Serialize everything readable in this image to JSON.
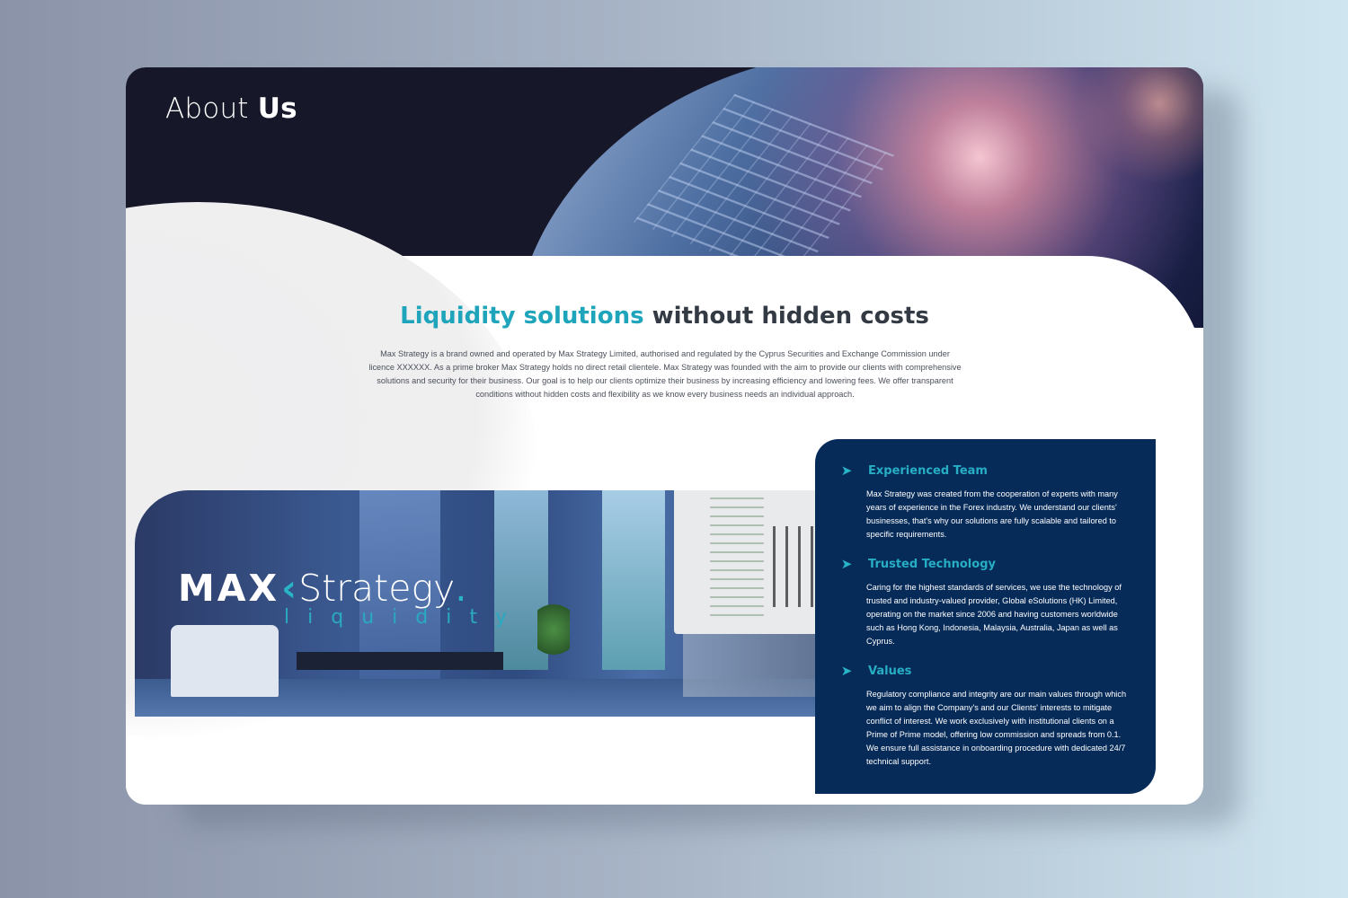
{
  "hero": {
    "title_light": "About",
    "title_bold": "Us"
  },
  "intro": {
    "title_accent": "Liquidity solutions",
    "title_rest": "without hidden costs",
    "body": "Max Strategy is a brand owned and operated by Max Strategy Limited, authorised and regulated by the Cyprus Securities and Exchange Commission under licence XXXXXX. As a prime broker Max Strategy holds no direct retail clientele. Max Strategy was founded with the aim to provide our clients with comprehensive solutions and security for their business. Our goal is to help our clients optimize their business by increasing efficiency and lowering fees. We offer transparent conditions without hidden costs and flexibility as we know every business needs an individual approach."
  },
  "logo": {
    "max": "MAX",
    "mark": "‹",
    "strategy": "Strategy",
    "dot": ".",
    "sub": "liquidity"
  },
  "features": [
    {
      "icon": "arrow-right-icon",
      "title": "Experienced Team",
      "text": "Max Strategy was created from the cooperation of experts with many years of experience in the Forex industry. We understand our clients' businesses, that's why our solutions are fully scalable and tailored to specific requirements."
    },
    {
      "icon": "arrow-right-icon",
      "title": "Trusted Technology",
      "text": "Caring for the highest standards of services, we use the technology of trusted and industry-valued provider, Global eSolutions (HK) Limited, operating on the market since 2006 and having customers worldwide such as Hong Kong, Indonesia, Malaysia, Australia, Japan as well as Cyprus."
    },
    {
      "icon": "arrow-right-icon",
      "title": "Values",
      "text": "Regulatory compliance and integrity are our main values through which we aim to align the Company's and our Clients' interests to mitigate conflict of interest. We work exclusively with institutional clients on a Prime of Prime model, offering low commission and spreads from 0.1. We ensure full assistance in onboarding procedure with dedicated 24/7 technical support."
    }
  ],
  "colors": {
    "accent": "#1fa5bb",
    "panel": "#062b59",
    "hero": "#17172a"
  }
}
